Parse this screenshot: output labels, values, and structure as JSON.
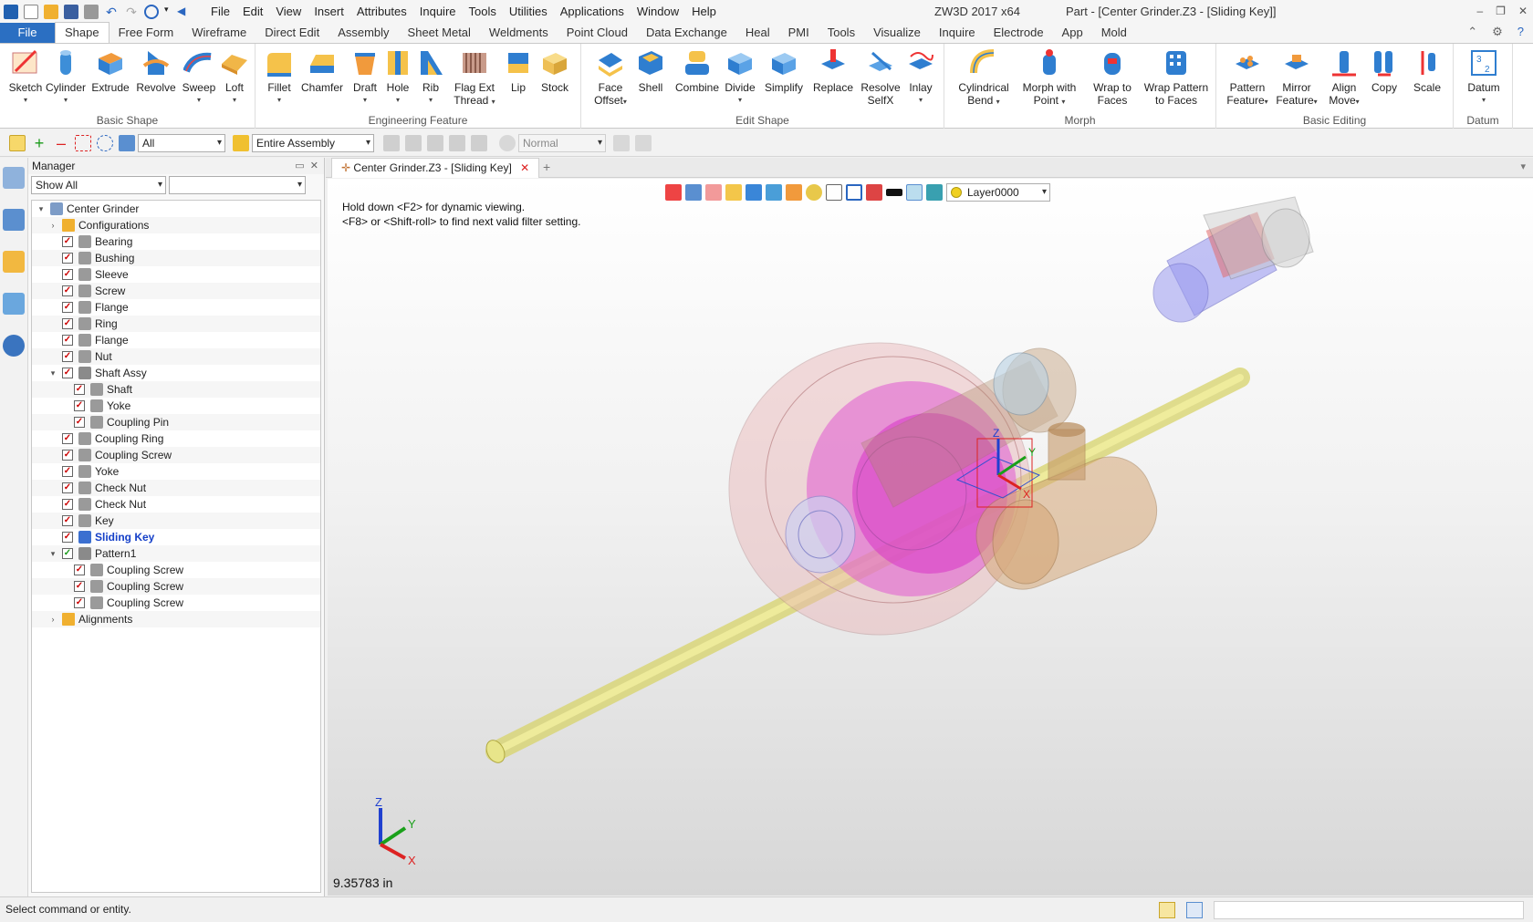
{
  "titlebar": {
    "menu": [
      "File",
      "Edit",
      "View",
      "Insert",
      "Attributes",
      "Inquire",
      "Tools",
      "Utilities",
      "Applications",
      "Window",
      "Help"
    ],
    "app_name": "ZW3D 2017  x64",
    "doc_title": "Part - [Center Grinder.Z3 - [Sliding Key]]"
  },
  "ribbon_tabs": [
    "File",
    "Shape",
    "Free Form",
    "Wireframe",
    "Direct Edit",
    "Assembly",
    "Sheet Metal",
    "Weldments",
    "Point Cloud",
    "Data Exchange",
    "Heal",
    "PMI",
    "Tools",
    "Visualize",
    "Inquire",
    "Electrode",
    "App",
    "Mold"
  ],
  "ribbon_active_tab": "Shape",
  "ribbon": {
    "basic_shape": {
      "title": "Basic Shape",
      "buttons": [
        "Sketch",
        "Cylinder",
        "Extrude",
        "Revolve",
        "Sweep",
        "Loft"
      ]
    },
    "engineering_feature": {
      "title": "Engineering Feature",
      "buttons": [
        "Fillet",
        "Chamfer",
        "Draft",
        "Hole",
        "Rib",
        "Flag Ext",
        "Lip",
        "Stock"
      ],
      "flag_ext_line2": "Thread"
    },
    "edit_shape": {
      "title": "Edit Shape",
      "buttons": [
        "Face",
        "Shell",
        "Combine",
        "Divide",
        "Simplify",
        "Replace",
        "Resolve",
        "Inlay"
      ],
      "face_line2": "Offset",
      "resolve_line2": "SelfX"
    },
    "morph": {
      "title": "Morph",
      "cyl_bend": [
        "Cylindrical",
        "Bend"
      ],
      "morph_point": [
        "Morph with",
        "Point"
      ],
      "wrap_faces": [
        "Wrap to",
        "Faces"
      ],
      "wrap_pattern": [
        "Wrap Pattern",
        "to Faces"
      ]
    },
    "basic_editing": {
      "title": "Basic Editing",
      "pattern": [
        "Pattern",
        "Feature"
      ],
      "mirror": [
        "Mirror",
        "Feature"
      ],
      "align": [
        "Align",
        "Move"
      ],
      "copy": "Copy",
      "scale": "Scale"
    },
    "datum": {
      "title": "Datum",
      "button": "Datum"
    }
  },
  "filterbar": {
    "filter_value": "All",
    "scope_value": "Entire Assembly",
    "mode_value": "Normal"
  },
  "manager": {
    "title": "Manager",
    "show_filter": "Show All",
    "tree": [
      {
        "label": "Center Grinder",
        "level": 0,
        "expand": "down",
        "check": "",
        "icon": "assembly"
      },
      {
        "label": "Configurations",
        "level": 1,
        "expand": "right",
        "check": "",
        "icon": "folder"
      },
      {
        "label": "Bearing",
        "level": 1,
        "expand": "",
        "check": "red",
        "icon": "part"
      },
      {
        "label": "Bushing",
        "level": 1,
        "expand": "",
        "check": "red",
        "icon": "part"
      },
      {
        "label": "Sleeve",
        "level": 1,
        "expand": "",
        "check": "red",
        "icon": "part"
      },
      {
        "label": "Screw",
        "level": 1,
        "expand": "",
        "check": "red",
        "icon": "part"
      },
      {
        "label": "Flange",
        "level": 1,
        "expand": "",
        "check": "red",
        "icon": "part"
      },
      {
        "label": "Ring",
        "level": 1,
        "expand": "",
        "check": "red",
        "icon": "part"
      },
      {
        "label": "Flange",
        "level": 1,
        "expand": "",
        "check": "red",
        "icon": "part"
      },
      {
        "label": "Nut",
        "level": 1,
        "expand": "",
        "check": "red",
        "icon": "part"
      },
      {
        "label": "Shaft Assy",
        "level": 1,
        "expand": "down",
        "check": "red",
        "icon": "subassy"
      },
      {
        "label": "Shaft",
        "level": 2,
        "expand": "",
        "check": "red",
        "icon": "part"
      },
      {
        "label": "Yoke",
        "level": 2,
        "expand": "",
        "check": "red",
        "icon": "part"
      },
      {
        "label": "Coupling Pin",
        "level": 2,
        "expand": "",
        "check": "red",
        "icon": "part"
      },
      {
        "label": "Coupling Ring",
        "level": 1,
        "expand": "",
        "check": "red",
        "icon": "part"
      },
      {
        "label": "Coupling Screw",
        "level": 1,
        "expand": "",
        "check": "red",
        "icon": "part"
      },
      {
        "label": "Yoke",
        "level": 1,
        "expand": "",
        "check": "red",
        "icon": "part"
      },
      {
        "label": "Check Nut",
        "level": 1,
        "expand": "",
        "check": "red",
        "icon": "part"
      },
      {
        "label": "Check Nut",
        "level": 1,
        "expand": "",
        "check": "red",
        "icon": "part"
      },
      {
        "label": "Key",
        "level": 1,
        "expand": "",
        "check": "red",
        "icon": "part"
      },
      {
        "label": "Sliding Key",
        "level": 1,
        "expand": "",
        "check": "red",
        "icon": "part-active",
        "selected": true
      },
      {
        "label": "Pattern1",
        "level": 1,
        "expand": "down",
        "check": "green",
        "icon": "pattern"
      },
      {
        "label": "Coupling Screw",
        "level": 2,
        "expand": "",
        "check": "red",
        "icon": "part"
      },
      {
        "label": "Coupling Screw",
        "level": 2,
        "expand": "",
        "check": "red",
        "icon": "part"
      },
      {
        "label": "Coupling Screw",
        "level": 2,
        "expand": "",
        "check": "red",
        "icon": "part"
      },
      {
        "label": "Alignments",
        "level": 1,
        "expand": "right",
        "check": "",
        "icon": "folder"
      }
    ]
  },
  "document_tab": "Center Grinder.Z3 - [Sliding Key]",
  "viewport": {
    "hint_line1": "Hold down <F2> for dynamic viewing.",
    "hint_line2": "<F8> or <Shift-roll> to find next valid filter setting.",
    "layer": "Layer0000",
    "scale_readout": "9.35783 in",
    "axis_x": "X",
    "axis_y": "Y",
    "axis_z": "Z"
  },
  "statusbar": {
    "message": "Select command or entity."
  },
  "colors": {
    "file_tab": "#2b6fc2",
    "selected_tree_text": "#1540c8",
    "shaft": "#e8e58a",
    "disc_magenta": "#e03fd6",
    "yoke_blue": "#8f8ff0"
  }
}
